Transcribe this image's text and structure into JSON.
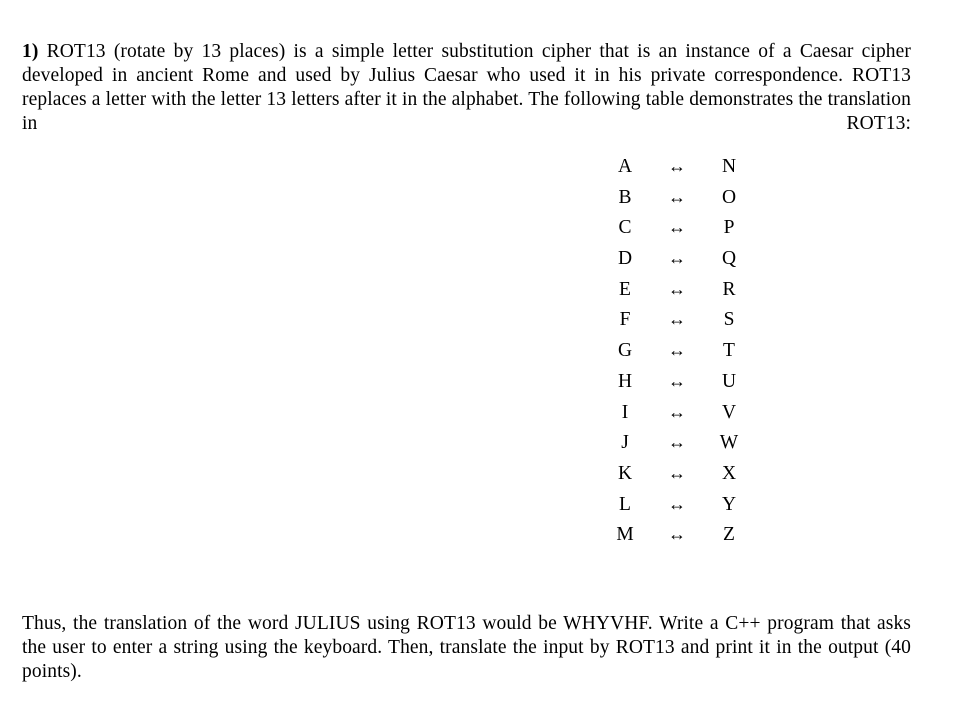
{
  "document": {
    "background_color": "#ffffff",
    "text_color": "#000000"
  },
  "intro": {
    "number_label": "1)",
    "body": " ROT13 (rotate by 13 places) is a simple letter substitution cipher that is an instance of a Caesar cipher developed in ancient Rome and used by Julius Caesar who used it in his private correspondence. ROT13 replaces a letter with the letter 13 letters after it in the alphabet. The following table demonstrates the translation in ROT13:"
  },
  "cipher_table": {
    "arrow_symbol": "↔",
    "rows": [
      {
        "plain": "A",
        "arrow": "↔",
        "cipher": "N"
      },
      {
        "plain": "B",
        "arrow": "↔",
        "cipher": "O"
      },
      {
        "plain": "C",
        "arrow": "↔",
        "cipher": "P"
      },
      {
        "plain": "D",
        "arrow": "↔",
        "cipher": "Q"
      },
      {
        "plain": "E",
        "arrow": "↔",
        "cipher": "R"
      },
      {
        "plain": "F",
        "arrow": "↔",
        "cipher": "S"
      },
      {
        "plain": "G",
        "arrow": "↔",
        "cipher": "T"
      },
      {
        "plain": "H",
        "arrow": "↔",
        "cipher": "U"
      },
      {
        "plain": "I",
        "arrow": "↔",
        "cipher": "V"
      },
      {
        "plain": "J",
        "arrow": "↔",
        "cipher": "W"
      },
      {
        "plain": "K",
        "arrow": "↔",
        "cipher": "X"
      },
      {
        "plain": "L",
        "arrow": "↔",
        "cipher": "Y"
      },
      {
        "plain": "M",
        "arrow": "↔",
        "cipher": "Z"
      }
    ]
  },
  "closing": {
    "body": "Thus, the translation of the word JULIUS using ROT13 would be WHYVHF. Write a C++ program that asks the user to enter a string using the keyboard. Then, translate the input by ROT13 and print it in the output (40 points)."
  }
}
